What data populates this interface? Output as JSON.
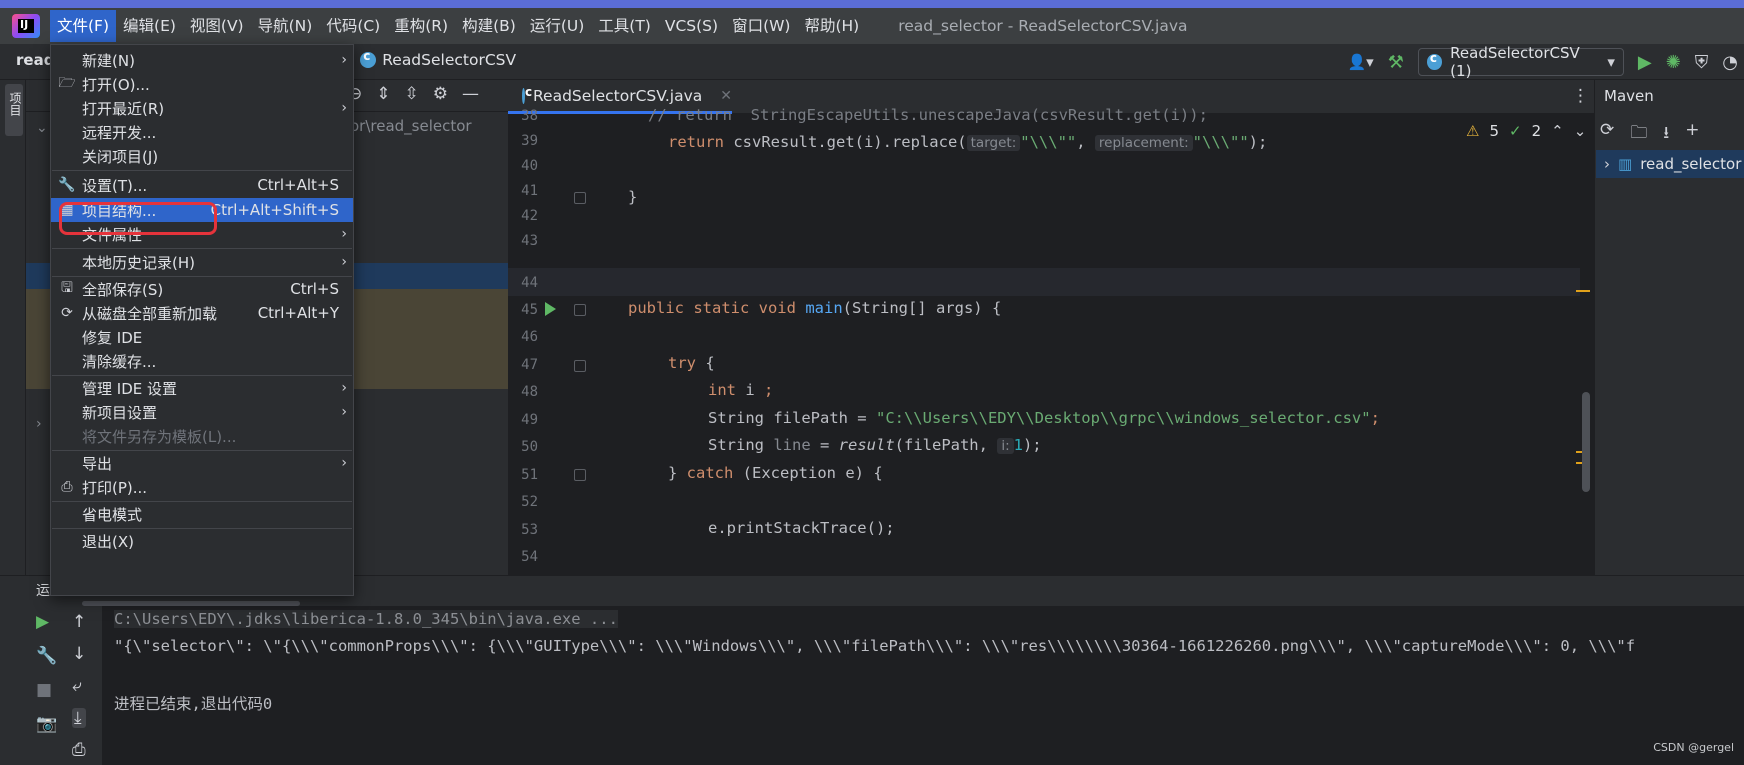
{
  "app": {
    "logo": "IJ",
    "window_title": "read_selector - ReadSelectorCSV.java"
  },
  "menubar": {
    "items": [
      "文件(F)",
      "编辑(E)",
      "视图(V)",
      "导航(N)",
      "代码(C)",
      "重构(R)",
      "构建(B)",
      "运行(U)",
      "工具(T)",
      "VCS(S)",
      "窗口(W)",
      "帮助(H)"
    ],
    "active_index": 0
  },
  "navbar": {
    "project_short": "read",
    "breadcrumb_file": "ReadSelectorCSV",
    "run_config": "ReadSelectorCSV (1)"
  },
  "left_strip": {
    "project_tab": "项目"
  },
  "project_panel": {
    "path_fragment": "or\\read_selector"
  },
  "editor": {
    "tab_label": "ReadSelectorCSV.java",
    "inspection": {
      "warnings": "5",
      "ok": "2"
    },
    "line_numbers": [
      "38",
      "39",
      "40",
      "41",
      "42",
      "43",
      "44",
      "45",
      "46",
      "47",
      "48",
      "49",
      "50",
      "51",
      "52",
      "53",
      "54"
    ],
    "code": {
      "l38": "// return  StringEscapeUtils.unescapeJava(csvResult.get(i));",
      "l39_kw": "return",
      "l39_a": " csvResult.get(i).replace(",
      "l39_hint1": "target:",
      "l39_s1": "\"\\\\\\\"\"",
      "l39_comma": ", ",
      "l39_hint2": "replacement:",
      "l39_s2": "\"\\\\\\\"\"",
      "l39_end": ");",
      "l41": "}",
      "l45_kw": "public static void",
      "l45_fn": "main",
      "l45_rest": "(String[] args) {",
      "l47_kw": "try",
      "l47_rest": " {",
      "l48_kw": "int",
      "l48_rest": " i ",
      "l48_semi": ";",
      "l49_a": "String filePath = ",
      "l49_s": "\"C:\\\\Users\\\\EDY\\\\Desktop\\\\grpc\\\\windows_selector.csv\"",
      "l49_end": ";",
      "l50_a": "String ",
      "l50_line": "line",
      "l50_b": " = ",
      "l50_fn": "result",
      "l50_c": "(filePath, ",
      "l50_hint": "i:",
      "l50_num": "1",
      "l50_end": ");",
      "l51_a": "} ",
      "l51_kw": "catch",
      "l51_rest": " (Exception e) {",
      "l53": "e.printStackTrace();"
    }
  },
  "maven": {
    "title": "Maven",
    "root_item": "read_selector"
  },
  "run_panel": {
    "label": "运",
    "console_lines": [
      "C:\\Users\\EDY\\.jdks\\liberica-1.8.0_345\\bin\\java.exe ...",
      "\"{\\\"selector\\\": \\\"{\\\\\\\"commonProps\\\\\\\": {\\\\\\\"GUIType\\\\\\\": \\\\\\\"Windows\\\\\\\", \\\\\\\"filePath\\\\\\\": \\\\\\\"res\\\\\\\\\\\\\\\\30364-1661226260.png\\\\\\\", \\\\\\\"captureMode\\\\\\\": 0, \\\\\\\"f",
      "进程已结束,退出代码0"
    ],
    "watermark": "CSDN @gergel"
  },
  "file_menu": {
    "items": [
      {
        "label": "新建(N)",
        "icon": "",
        "shortcut": "",
        "submenu": true
      },
      {
        "label": "打开(O)...",
        "icon": "folder-icon",
        "shortcut": "",
        "submenu": false
      },
      {
        "label": "打开最近(R)",
        "icon": "",
        "shortcut": "",
        "submenu": true
      },
      {
        "label": "远程开发...",
        "icon": "",
        "shortcut": "",
        "submenu": false
      },
      {
        "label": "关闭项目(J)",
        "icon": "",
        "shortcut": "",
        "submenu": false
      },
      {
        "label": "设置(T)...",
        "icon": "wrench-icon",
        "shortcut": "Ctrl+Alt+S",
        "submenu": false
      },
      {
        "label": "项目结构...",
        "icon": "project-structure-icon",
        "shortcut": "Ctrl+Alt+Shift+S",
        "submenu": false
      },
      {
        "label": "文件属性",
        "icon": "",
        "shortcut": "",
        "submenu": true
      },
      {
        "label": "本地历史记录(H)",
        "icon": "",
        "shortcut": "",
        "submenu": true
      },
      {
        "label": "全部保存(S)",
        "icon": "save-icon",
        "shortcut": "Ctrl+S",
        "submenu": false
      },
      {
        "label": "从磁盘全部重新加载",
        "icon": "reload-icon",
        "shortcut": "Ctrl+Alt+Y",
        "submenu": false
      },
      {
        "label": "修复 IDE",
        "icon": "",
        "shortcut": "",
        "submenu": false
      },
      {
        "label": "清除缓存...",
        "icon": "",
        "shortcut": "",
        "submenu": false
      },
      {
        "label": "管理 IDE 设置",
        "icon": "",
        "shortcut": "",
        "submenu": true
      },
      {
        "label": "新项目设置",
        "icon": "",
        "shortcut": "",
        "submenu": true
      },
      {
        "label": "将文件另存为模板(L)...",
        "icon": "",
        "shortcut": "",
        "submenu": false,
        "disabled": true
      },
      {
        "label": "导出",
        "icon": "",
        "shortcut": "",
        "submenu": true
      },
      {
        "label": "打印(P)...",
        "icon": "print-icon",
        "shortcut": "",
        "submenu": false
      },
      {
        "label": "省电模式",
        "icon": "",
        "shortcut": "",
        "submenu": false
      },
      {
        "label": "退出(X)",
        "icon": "",
        "shortcut": "",
        "submenu": false
      }
    ],
    "highlighted_index": 6
  },
  "colors": {
    "accent": "#2f65ca",
    "annotation_box": "#e5333b",
    "run_green": "#5fb865"
  }
}
